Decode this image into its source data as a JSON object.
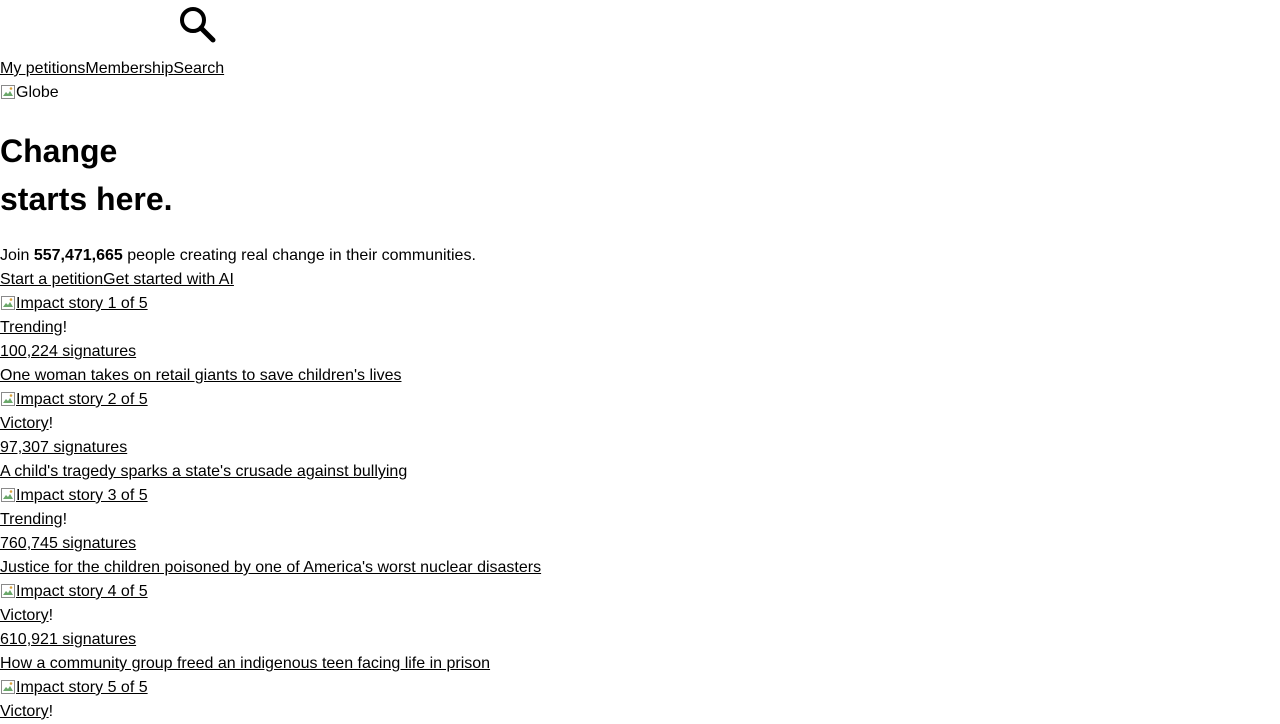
{
  "header": {
    "search_icon": "magnifier-icon"
  },
  "nav": {
    "items": [
      {
        "label": "My petitions"
      },
      {
        "label": "Membership"
      },
      {
        "label": "Search"
      }
    ]
  },
  "hero": {
    "globe_alt": "Globe",
    "title_line1": "Change",
    "title_line2": "starts here.",
    "join_prefix": "Join",
    "member_count": "557,471,665",
    "join_suffix": "people creating real change in their communities."
  },
  "ctas": {
    "start_petition": "Start a petition",
    "get_started_ai": "Get started with AI"
  },
  "stories": [
    {
      "image_alt": "Impact story 1 of 5",
      "status": "Trending",
      "status_mark": "!",
      "signatures": "100,224 signatures",
      "headline": "One woman takes on retail giants to save children's lives"
    },
    {
      "image_alt": "Impact story 2 of 5",
      "status": "Victory",
      "status_mark": "!",
      "signatures": "97,307 signatures",
      "headline": "A child's tragedy sparks a state's crusade against bullying"
    },
    {
      "image_alt": "Impact story 3 of 5",
      "status": "Trending",
      "status_mark": "!",
      "signatures": "760,745 signatures",
      "headline": "Justice for the children poisoned by one of America's worst nuclear disasters"
    },
    {
      "image_alt": "Impact story 4 of 5",
      "status": "Victory",
      "status_mark": "!",
      "signatures": "610,921 signatures",
      "headline": "How a community group freed an indigenous teen facing life in prison"
    },
    {
      "image_alt": "Impact story 5 of 5",
      "status": "Victory",
      "status_mark": "!",
      "signatures": "",
      "headline": ""
    }
  ]
}
